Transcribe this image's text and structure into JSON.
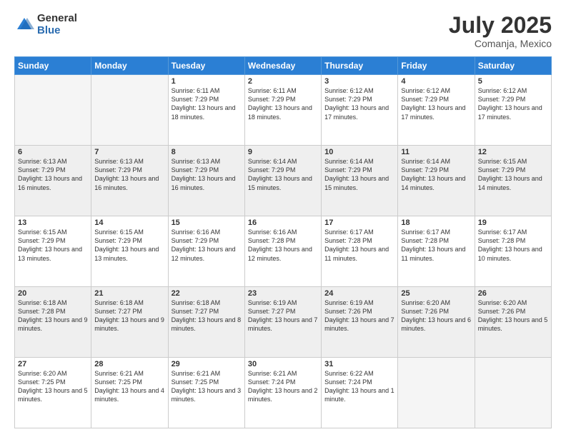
{
  "header": {
    "logo_general": "General",
    "logo_blue": "Blue",
    "month_title": "July 2025",
    "location": "Comanja, Mexico"
  },
  "weekdays": [
    "Sunday",
    "Monday",
    "Tuesday",
    "Wednesday",
    "Thursday",
    "Friday",
    "Saturday"
  ],
  "weeks": [
    [
      {
        "day": "",
        "empty": true
      },
      {
        "day": "",
        "empty": true
      },
      {
        "day": "1",
        "sunrise": "6:11 AM",
        "sunset": "7:29 PM",
        "daylight": "13 hours and 18 minutes."
      },
      {
        "day": "2",
        "sunrise": "6:11 AM",
        "sunset": "7:29 PM",
        "daylight": "13 hours and 18 minutes."
      },
      {
        "day": "3",
        "sunrise": "6:12 AM",
        "sunset": "7:29 PM",
        "daylight": "13 hours and 17 minutes."
      },
      {
        "day": "4",
        "sunrise": "6:12 AM",
        "sunset": "7:29 PM",
        "daylight": "13 hours and 17 minutes."
      },
      {
        "day": "5",
        "sunrise": "6:12 AM",
        "sunset": "7:29 PM",
        "daylight": "13 hours and 17 minutes."
      }
    ],
    [
      {
        "day": "6",
        "sunrise": "6:13 AM",
        "sunset": "7:29 PM",
        "daylight": "13 hours and 16 minutes."
      },
      {
        "day": "7",
        "sunrise": "6:13 AM",
        "sunset": "7:29 PM",
        "daylight": "13 hours and 16 minutes."
      },
      {
        "day": "8",
        "sunrise": "6:13 AM",
        "sunset": "7:29 PM",
        "daylight": "13 hours and 16 minutes."
      },
      {
        "day": "9",
        "sunrise": "6:14 AM",
        "sunset": "7:29 PM",
        "daylight": "13 hours and 15 minutes."
      },
      {
        "day": "10",
        "sunrise": "6:14 AM",
        "sunset": "7:29 PM",
        "daylight": "13 hours and 15 minutes."
      },
      {
        "day": "11",
        "sunrise": "6:14 AM",
        "sunset": "7:29 PM",
        "daylight": "13 hours and 14 minutes."
      },
      {
        "day": "12",
        "sunrise": "6:15 AM",
        "sunset": "7:29 PM",
        "daylight": "13 hours and 14 minutes."
      }
    ],
    [
      {
        "day": "13",
        "sunrise": "6:15 AM",
        "sunset": "7:29 PM",
        "daylight": "13 hours and 13 minutes."
      },
      {
        "day": "14",
        "sunrise": "6:15 AM",
        "sunset": "7:29 PM",
        "daylight": "13 hours and 13 minutes."
      },
      {
        "day": "15",
        "sunrise": "6:16 AM",
        "sunset": "7:29 PM",
        "daylight": "13 hours and 12 minutes."
      },
      {
        "day": "16",
        "sunrise": "6:16 AM",
        "sunset": "7:28 PM",
        "daylight": "13 hours and 12 minutes."
      },
      {
        "day": "17",
        "sunrise": "6:17 AM",
        "sunset": "7:28 PM",
        "daylight": "13 hours and 11 minutes."
      },
      {
        "day": "18",
        "sunrise": "6:17 AM",
        "sunset": "7:28 PM",
        "daylight": "13 hours and 11 minutes."
      },
      {
        "day": "19",
        "sunrise": "6:17 AM",
        "sunset": "7:28 PM",
        "daylight": "13 hours and 10 minutes."
      }
    ],
    [
      {
        "day": "20",
        "sunrise": "6:18 AM",
        "sunset": "7:28 PM",
        "daylight": "13 hours and 9 minutes."
      },
      {
        "day": "21",
        "sunrise": "6:18 AM",
        "sunset": "7:27 PM",
        "daylight": "13 hours and 9 minutes."
      },
      {
        "day": "22",
        "sunrise": "6:18 AM",
        "sunset": "7:27 PM",
        "daylight": "13 hours and 8 minutes."
      },
      {
        "day": "23",
        "sunrise": "6:19 AM",
        "sunset": "7:27 PM",
        "daylight": "13 hours and 7 minutes."
      },
      {
        "day": "24",
        "sunrise": "6:19 AM",
        "sunset": "7:26 PM",
        "daylight": "13 hours and 7 minutes."
      },
      {
        "day": "25",
        "sunrise": "6:20 AM",
        "sunset": "7:26 PM",
        "daylight": "13 hours and 6 minutes."
      },
      {
        "day": "26",
        "sunrise": "6:20 AM",
        "sunset": "7:26 PM",
        "daylight": "13 hours and 5 minutes."
      }
    ],
    [
      {
        "day": "27",
        "sunrise": "6:20 AM",
        "sunset": "7:25 PM",
        "daylight": "13 hours and 5 minutes."
      },
      {
        "day": "28",
        "sunrise": "6:21 AM",
        "sunset": "7:25 PM",
        "daylight": "13 hours and 4 minutes."
      },
      {
        "day": "29",
        "sunrise": "6:21 AM",
        "sunset": "7:25 PM",
        "daylight": "13 hours and 3 minutes."
      },
      {
        "day": "30",
        "sunrise": "6:21 AM",
        "sunset": "7:24 PM",
        "daylight": "13 hours and 2 minutes."
      },
      {
        "day": "31",
        "sunrise": "6:22 AM",
        "sunset": "7:24 PM",
        "daylight": "13 hours and 1 minute."
      },
      {
        "day": "",
        "empty": true
      },
      {
        "day": "",
        "empty": true
      }
    ]
  ]
}
